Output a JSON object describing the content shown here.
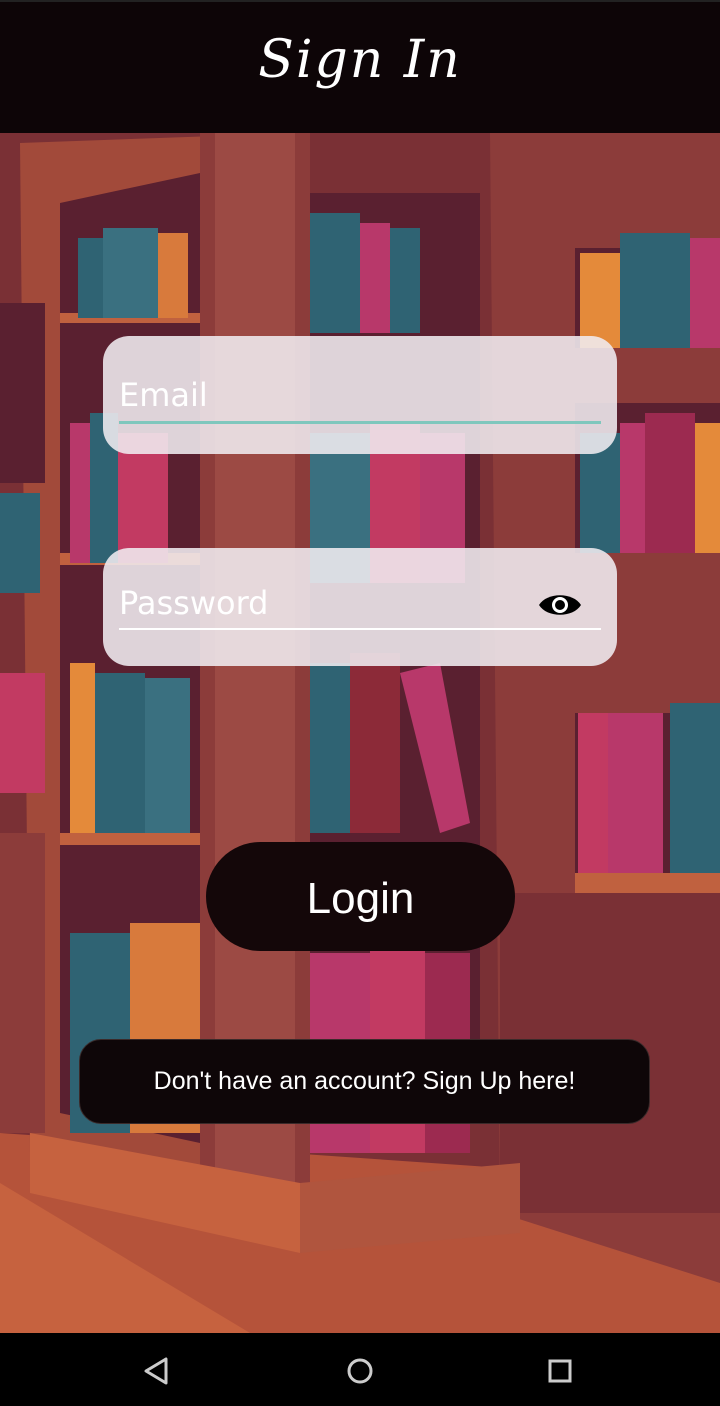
{
  "header": {
    "title": "Sign In"
  },
  "form": {
    "email_placeholder": "Email",
    "password_placeholder": "Password",
    "login_label": "Login",
    "signup_text": "Don't have an account? Sign Up here!"
  },
  "navbar": {
    "back": "back-icon",
    "home": "home-icon",
    "recents": "recents-icon"
  },
  "colors": {
    "accent_line": "#7fc7bd",
    "header_bg": "#0d0507",
    "button_bg": "#140709"
  }
}
